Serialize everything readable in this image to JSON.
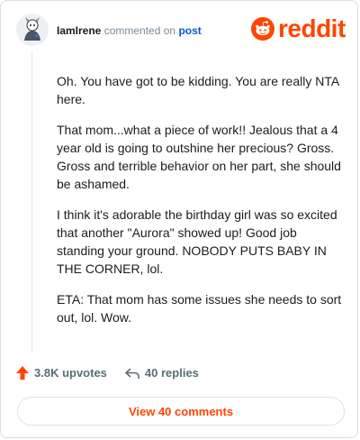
{
  "header": {
    "username": "IamIrene",
    "action_text": "commented on",
    "post_link": "post"
  },
  "brand": {
    "logo_text": "reddit",
    "accent_color": "#ff4500"
  },
  "comment": {
    "paragraphs": [
      "Oh. You have got to be kidding. You are really NTA here.",
      "That mom...what a piece of work!! Jealous that a 4 year old is going to outshine her precious? Gross. Gross and terrible behavior on her part, she should be ashamed.",
      "I think it's adorable the birthday girl was so excited that another \"Aurora\" showed up! Good job standing your ground. NOBODY PUTS BABY IN THE CORNER, lol.",
      "ETA: That mom has some issues she needs to sort out, lol. Wow."
    ]
  },
  "actions": {
    "upvotes": "3.8K upvotes",
    "replies": "40 replies",
    "upvote_icon": "upvote-arrow-icon",
    "reply_icon": "reply-arrow-icon"
  },
  "footer": {
    "view_comments_label": "View 40 comments"
  }
}
